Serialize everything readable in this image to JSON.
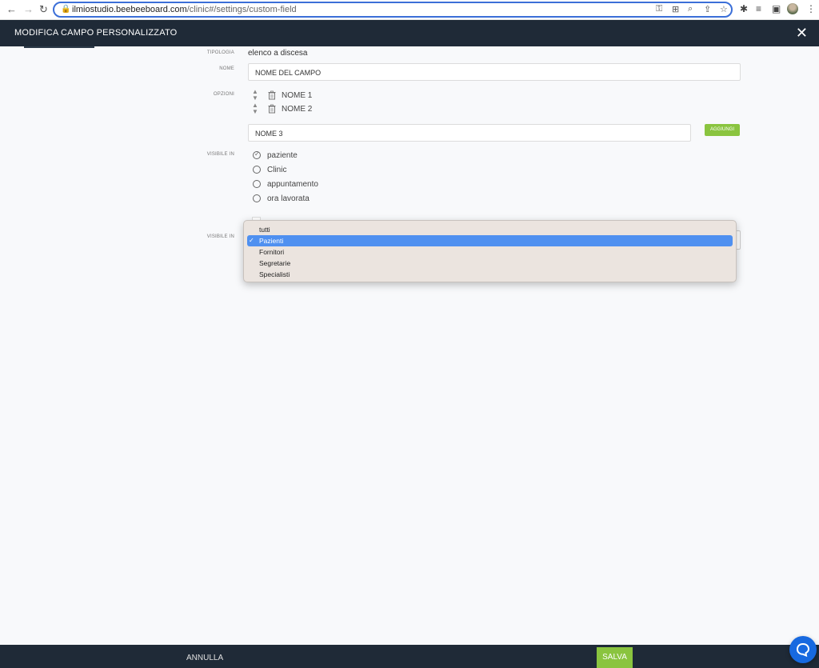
{
  "browser": {
    "url_host": "ilmiostudio.beebeeboard.com",
    "url_path": "/clinic#/settings/custom-field"
  },
  "modal": {
    "title": "MODIFICA CAMPO PERSONALIZZATO",
    "close_symbol": "✕"
  },
  "form": {
    "tipologia_label": "TIPOLOGIA",
    "tipologia_value": "elenco a discesa",
    "nome_label": "NOME",
    "nome_value": "NOME DEL CAMPO",
    "opzioni_label": "OPZIONI",
    "options": [
      {
        "label": "NOME 1"
      },
      {
        "label": "NOME 2"
      }
    ],
    "new_option_value": "NOME 3",
    "add_button": "AGGIUNGI",
    "visibile_label": "VISIBILE IN",
    "visibility": [
      {
        "label": "paziente",
        "checked": true
      },
      {
        "label": "Clinic",
        "checked": false
      },
      {
        "label": "appuntamento",
        "checked": false
      },
      {
        "label": "ora lavorata",
        "checked": false
      }
    ],
    "visibile2_label": "VISIBILE IN"
  },
  "dropdown": {
    "selected": "Pazienti",
    "options": [
      "tutti",
      "Pazienti",
      "Fornitori",
      "Segretarie",
      "Specialisti"
    ]
  },
  "footer": {
    "cancel": "ANNULLA",
    "save": "SALVA"
  },
  "colors": {
    "header_bg": "#1f2a37",
    "accent_green": "#8ac43f",
    "select_highlight": "#4f90f0",
    "chat_blue": "#1769e0"
  },
  "icons": [
    "lock-icon",
    "sort-icon",
    "trash-icon",
    "radio-icon",
    "check-icon",
    "close-icon",
    "chat-icon"
  ]
}
